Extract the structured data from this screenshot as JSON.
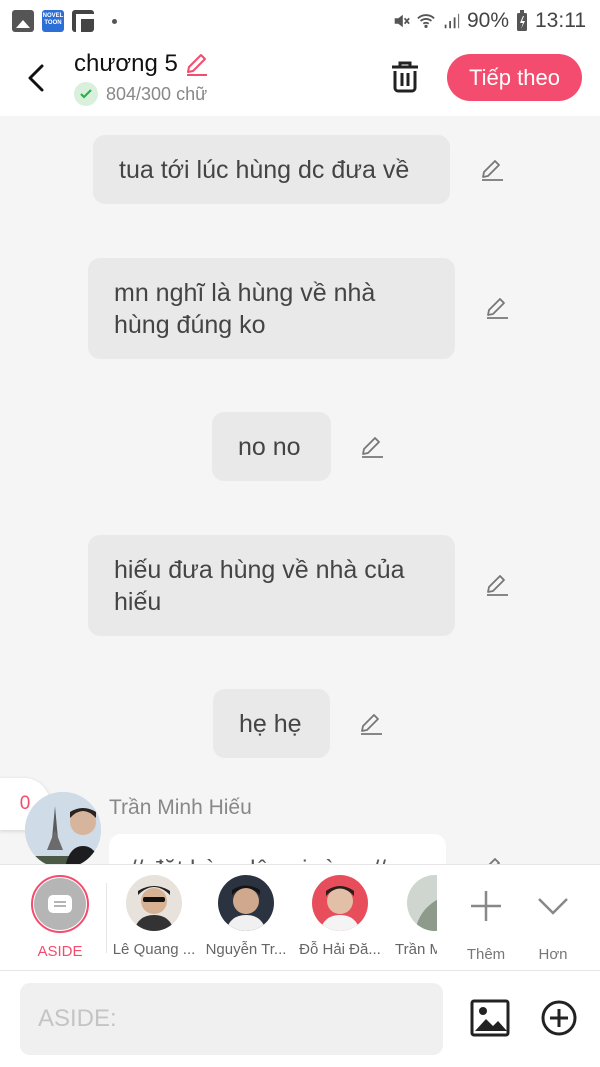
{
  "status_bar": {
    "battery": "90%",
    "time": "13:11",
    "novel_icon_text": "NOVEL TOON"
  },
  "header": {
    "chapter_title": "chương 5",
    "word_count": "804/300 chữ",
    "next_label": "Tiếp theo"
  },
  "messages": [
    {
      "text": "tua tới lúc hùng dc đưa về"
    },
    {
      "text": "mn nghĩ là hùng về nhà hùng đúng ko"
    },
    {
      "text": "no no"
    },
    {
      "text": "hiếu đưa hùng về nhà của hiếu"
    },
    {
      "text": "hẹ hẹ"
    }
  ],
  "comment_count": "0",
  "speaker": {
    "name": "Trần Minh Hiếu",
    "partial_text": "// đặt hùng lên giường //"
  },
  "characters": [
    {
      "name": "ASIDE",
      "selected": true
    },
    {
      "name": "Lê Quang ..."
    },
    {
      "name": "Nguyễn Tr..."
    },
    {
      "name": "Đỗ Hải Đă..."
    },
    {
      "name": "Trần M"
    }
  ],
  "strip_actions": {
    "add_label": "Thêm",
    "more_label": "Hơn"
  },
  "input": {
    "placeholder": "ASIDE:"
  },
  "colors": {
    "accent": "#f34c6e",
    "bubble": "#e9e9e9",
    "background": "#f5f5f5"
  }
}
